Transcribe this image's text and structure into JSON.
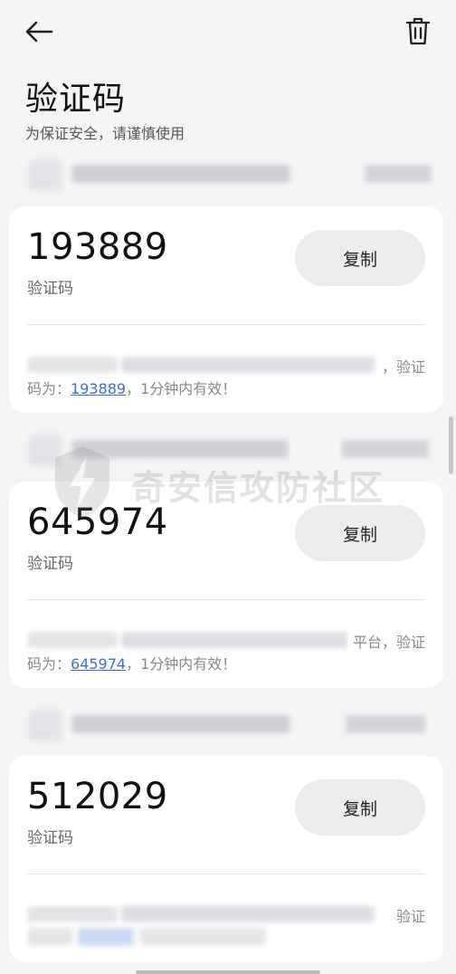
{
  "header": {
    "back_icon": "arrow-left-icon",
    "delete_icon": "trash-icon",
    "title": "验证码",
    "subtitle": "为保证安全，请谨慎使用"
  },
  "messages": [
    {
      "code": "193889",
      "code_label": "验证码",
      "copy_label": "复制",
      "line1_tail": "，验证",
      "line2_prefix": "码为：",
      "line2_code": "193889",
      "line2_suffix": "，1分钟内有效！"
    },
    {
      "code": "645974",
      "code_label": "验证码",
      "copy_label": "复制",
      "line1_tail": "平台，验证",
      "line2_prefix": "码为：",
      "line2_code": "645974",
      "line2_suffix": "，1分钟内有效！"
    },
    {
      "code": "512029",
      "code_label": "验证码",
      "copy_label": "复制",
      "line1_tail": "验证"
    }
  ],
  "watermark": {
    "text": "奇安信攻防社区"
  },
  "colors": {
    "link": "#3a6fd0",
    "card": "#ffffff",
    "background": "#f4f4f4"
  }
}
